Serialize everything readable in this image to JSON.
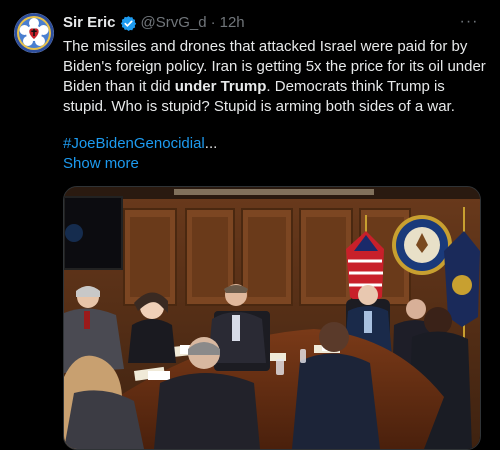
{
  "author": {
    "display_name": "Sir Eric",
    "handle": "@SrvG_d",
    "separator": "·",
    "time": "12h",
    "avatar_icon": "luther-rose-avatar-icon",
    "verified_icon": "verified-badge-icon"
  },
  "tweet": {
    "text_part1": "The missiles and drones that attacked Israel were paid for by Biden's foreign policy. Iran is getting 5x the price for its oil under Biden than it did ",
    "text_bold": "under Trump",
    "text_part2": ". Democrats think Trump is stupid. Who is stupid? Stupid is arming both sides of a war.",
    "hashtag": "#JoeBidenGenocidial",
    "ellipsis": "...",
    "show_more": "Show more",
    "more_icon": "···"
  },
  "media": {
    "type": "photo",
    "subject": "situation-room-meeting"
  },
  "colors": {
    "background": "#000000",
    "text": "#e7e9ea",
    "secondary": "#71767b",
    "link": "#1d9bf0",
    "verified": "#1d9bf0"
  }
}
